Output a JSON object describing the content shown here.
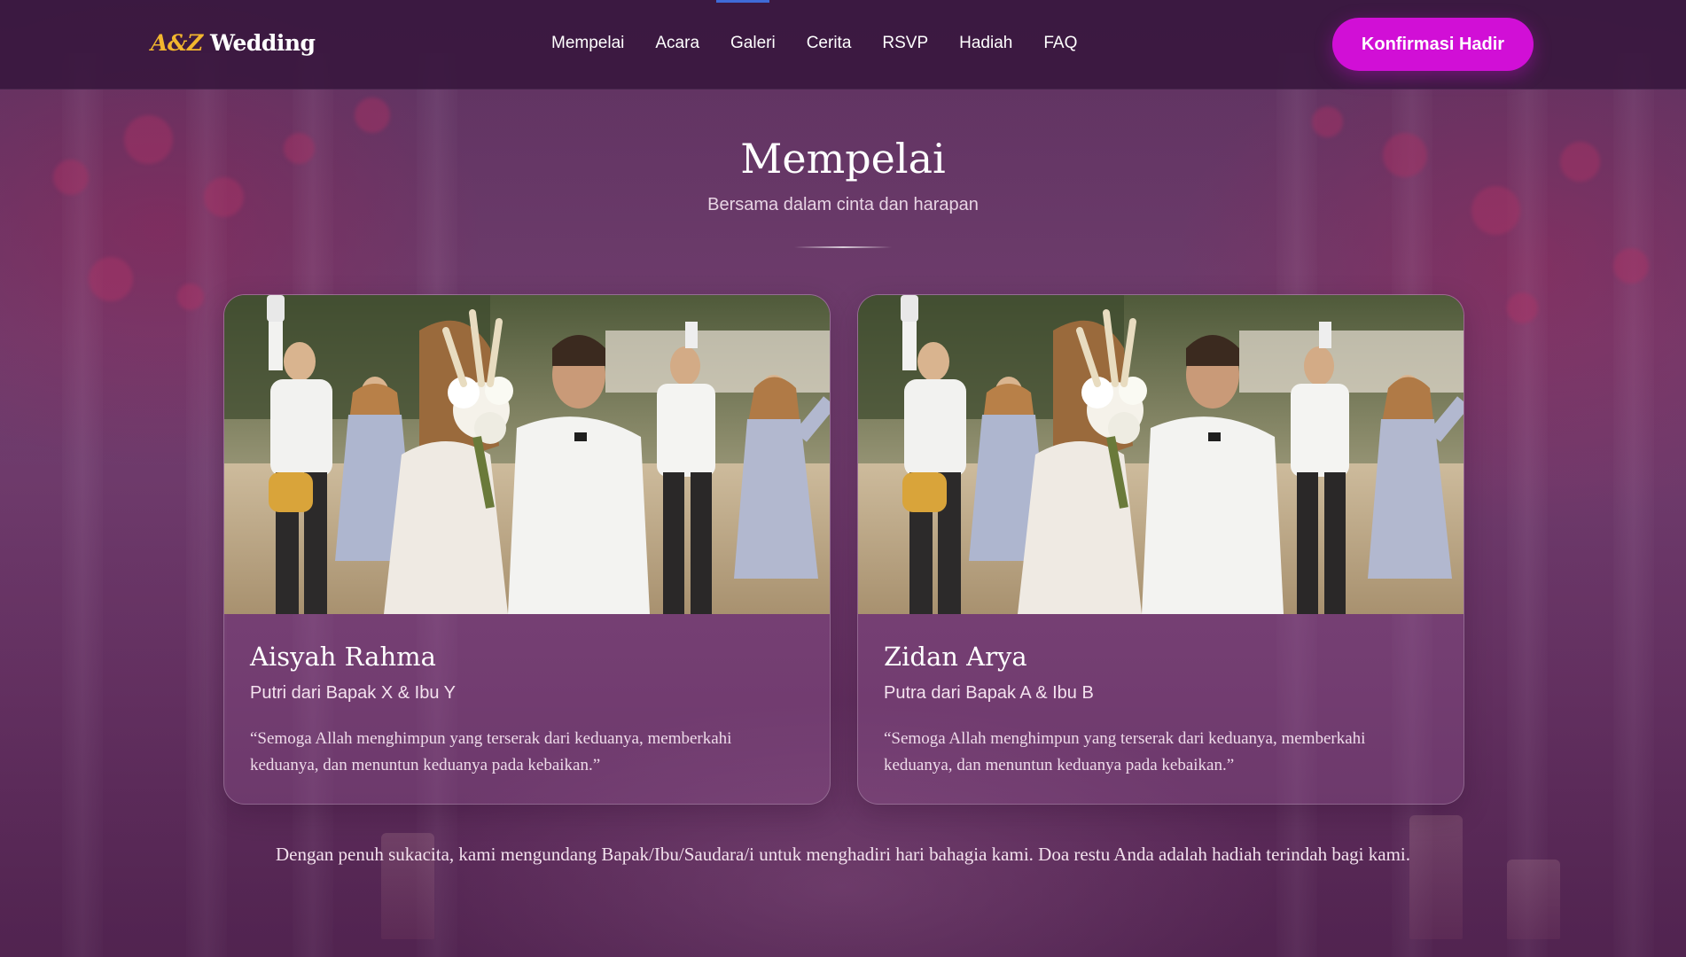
{
  "nav": {
    "brand_monogram": "A&Z",
    "brand_word": "Wedding",
    "links": [
      "Mempelai",
      "Acara",
      "Galeri",
      "Cerita",
      "RSVP",
      "Hadiah",
      "FAQ"
    ],
    "cta_label": "Konfirmasi Hadir"
  },
  "section": {
    "title": "Mempelai",
    "subtitle": "Bersama dalam cinta dan harapan"
  },
  "cards": [
    {
      "name": "Aisyah Rahma",
      "parents": "Putri dari Bapak X & Ibu Y",
      "quote": "“Semoga Allah menghimpun yang terserak dari keduanya, memberkahi keduanya, dan menuntun keduanya pada kebaikan.”"
    },
    {
      "name": "Zidan Arya",
      "parents": "Putra dari Bapak A & Ibu B",
      "quote": "“Semoga Allah menghimpun yang terserak dari keduanya, memberkahi keduanya, dan menuntun keduanya pada kebaikan.”"
    }
  ],
  "closing": "Dengan penuh sukacita, kami mengundang Bapak/Ibu/Saudara/i untuk menghadiri hari bahagia kami. Doa restu Anda adalah hadiah terindah bagi kami.",
  "colors": {
    "brand_gold": "#f2b62e",
    "cta_magenta": "#d10fd6",
    "nav_bg": "#37163c"
  },
  "icons": {
    "photo": "wedding-couple-photo"
  }
}
